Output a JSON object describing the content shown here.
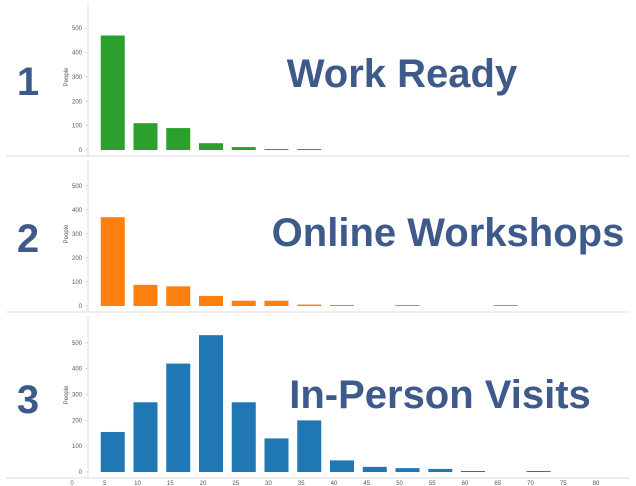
{
  "chart_data": [
    {
      "type": "bar",
      "panel_number": "1",
      "title": "Work Ready",
      "ylabel": "People",
      "ylim": [
        0,
        550
      ],
      "yticks": [
        0,
        100,
        200,
        300,
        400,
        500
      ],
      "color": "#2ca02c",
      "x": [
        5,
        10,
        15,
        20,
        25,
        30,
        35
      ],
      "values": [
        470,
        110,
        90,
        28,
        12,
        3,
        2
      ]
    },
    {
      "type": "bar",
      "panel_number": "2",
      "title": "Online Workshops",
      "ylabel": "People",
      "ylim": [
        0,
        550
      ],
      "yticks": [
        0,
        100,
        200,
        300,
        400,
        500
      ],
      "color": "#ff7f0e",
      "x": [
        5,
        10,
        15,
        20,
        25,
        30,
        35,
        40,
        50,
        65
      ],
      "values": [
        370,
        88,
        82,
        42,
        22,
        22,
        6,
        3,
        1,
        1
      ]
    },
    {
      "type": "bar",
      "panel_number": "3",
      "title": "In-Person Visits",
      "ylabel": "People",
      "ylim": [
        0,
        550
      ],
      "yticks": [
        0,
        100,
        200,
        300,
        400,
        500
      ],
      "color": "#1f77b4",
      "x": [
        5,
        10,
        15,
        20,
        25,
        30,
        35,
        40,
        45,
        50,
        55,
        60,
        70
      ],
      "values": [
        155,
        270,
        420,
        530,
        270,
        130,
        200,
        45,
        20,
        15,
        12,
        3,
        3
      ],
      "xticks": [
        0,
        5,
        10,
        15,
        20,
        25,
        30,
        35,
        40,
        45,
        50,
        55,
        60,
        65,
        70,
        75,
        80
      ]
    }
  ]
}
